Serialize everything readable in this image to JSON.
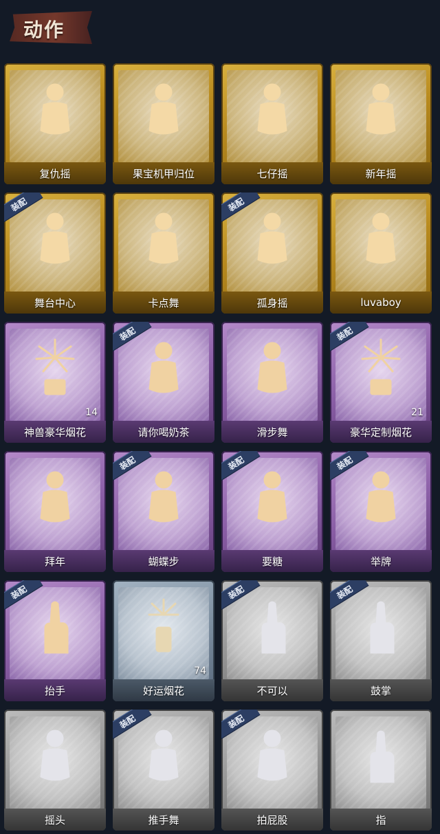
{
  "header": {
    "title": "动作"
  },
  "badge_text": "装配",
  "colors": {
    "gold": "#c79b2c",
    "purple": "#9a6cb6",
    "blue": "#7c8ea0",
    "gray": "#8e8e8e",
    "badge": "#2c3e63",
    "background": "#131a26"
  },
  "cards": [
    {
      "label": "复仇摇",
      "tier": "gold",
      "icon": "figure-pointing-up-icon",
      "equipped": false,
      "count": ""
    },
    {
      "label": "果宝机甲归位",
      "tier": "gold",
      "icon": "figure-arms-crossed-icon",
      "equipped": false,
      "count": ""
    },
    {
      "label": "七仔摇",
      "tier": "gold",
      "icon": "figure-dance-icon",
      "equipped": false,
      "count": ""
    },
    {
      "label": "新年摇",
      "tier": "gold",
      "icon": "figure-clap-icon",
      "equipped": false,
      "count": ""
    },
    {
      "label": "舞台中心",
      "tier": "gold",
      "icon": "figure-pose-icon",
      "equipped": true,
      "count": ""
    },
    {
      "label": "卡点舞",
      "tier": "gold",
      "icon": "figure-arm-raised-icon",
      "equipped": false,
      "count": ""
    },
    {
      "label": "孤身摇",
      "tier": "gold",
      "icon": "figure-shake-icon",
      "equipped": true,
      "count": ""
    },
    {
      "label": "luvaboy",
      "tier": "gold",
      "icon": "figure-cover-face-icon",
      "equipped": false,
      "count": ""
    },
    {
      "label": "神兽豪华烟花",
      "tier": "purple",
      "icon": "fireworks-box-icon",
      "equipped": false,
      "count": "14"
    },
    {
      "label": "请你喝奶茶",
      "tier": "purple",
      "icon": "figure-holding-sign-icon",
      "equipped": true,
      "count": ""
    },
    {
      "label": "滑步舞",
      "tier": "purple",
      "icon": "figure-slide-dance-icon",
      "equipped": false,
      "count": ""
    },
    {
      "label": "豪华定制烟花",
      "tier": "purple",
      "icon": "fireworks-crate-icon",
      "equipped": true,
      "count": "21"
    },
    {
      "label": "拜年",
      "tier": "purple",
      "icon": "figure-bow-icon",
      "equipped": false,
      "count": ""
    },
    {
      "label": "蝴蝶步",
      "tier": "purple",
      "icon": "figure-arms-out-icon",
      "equipped": true,
      "count": ""
    },
    {
      "label": "要糖",
      "tier": "purple",
      "icon": "figure-reach-icon",
      "equipped": true,
      "count": ""
    },
    {
      "label": "举牌",
      "tier": "purple",
      "icon": "figure-raise-sign-icon",
      "equipped": true,
      "count": ""
    },
    {
      "label": "抬手",
      "tier": "purple",
      "icon": "figure-raise-hand-icon",
      "equipped": true,
      "count": ""
    },
    {
      "label": "好运烟花",
      "tier": "blue",
      "icon": "firecracker-icon",
      "equipped": false,
      "count": "74"
    },
    {
      "label": "不可以",
      "tier": "gray",
      "icon": "finger-wag-icon",
      "equipped": true,
      "count": ""
    },
    {
      "label": "鼓掌",
      "tier": "gray",
      "icon": "clapping-hands-icon",
      "equipped": true,
      "count": ""
    },
    {
      "label": "摇头",
      "tier": "gray",
      "icon": "figure-shake-head-icon",
      "equipped": false,
      "count": ""
    },
    {
      "label": "推手舞",
      "tier": "gray",
      "icon": "figure-push-dance-icon",
      "equipped": true,
      "count": ""
    },
    {
      "label": "拍屁股",
      "tier": "gray",
      "icon": "figure-bend-icon",
      "equipped": true,
      "count": ""
    },
    {
      "label": "指",
      "tier": "gray",
      "icon": "pointing-hand-icon",
      "equipped": false,
      "count": ""
    }
  ]
}
